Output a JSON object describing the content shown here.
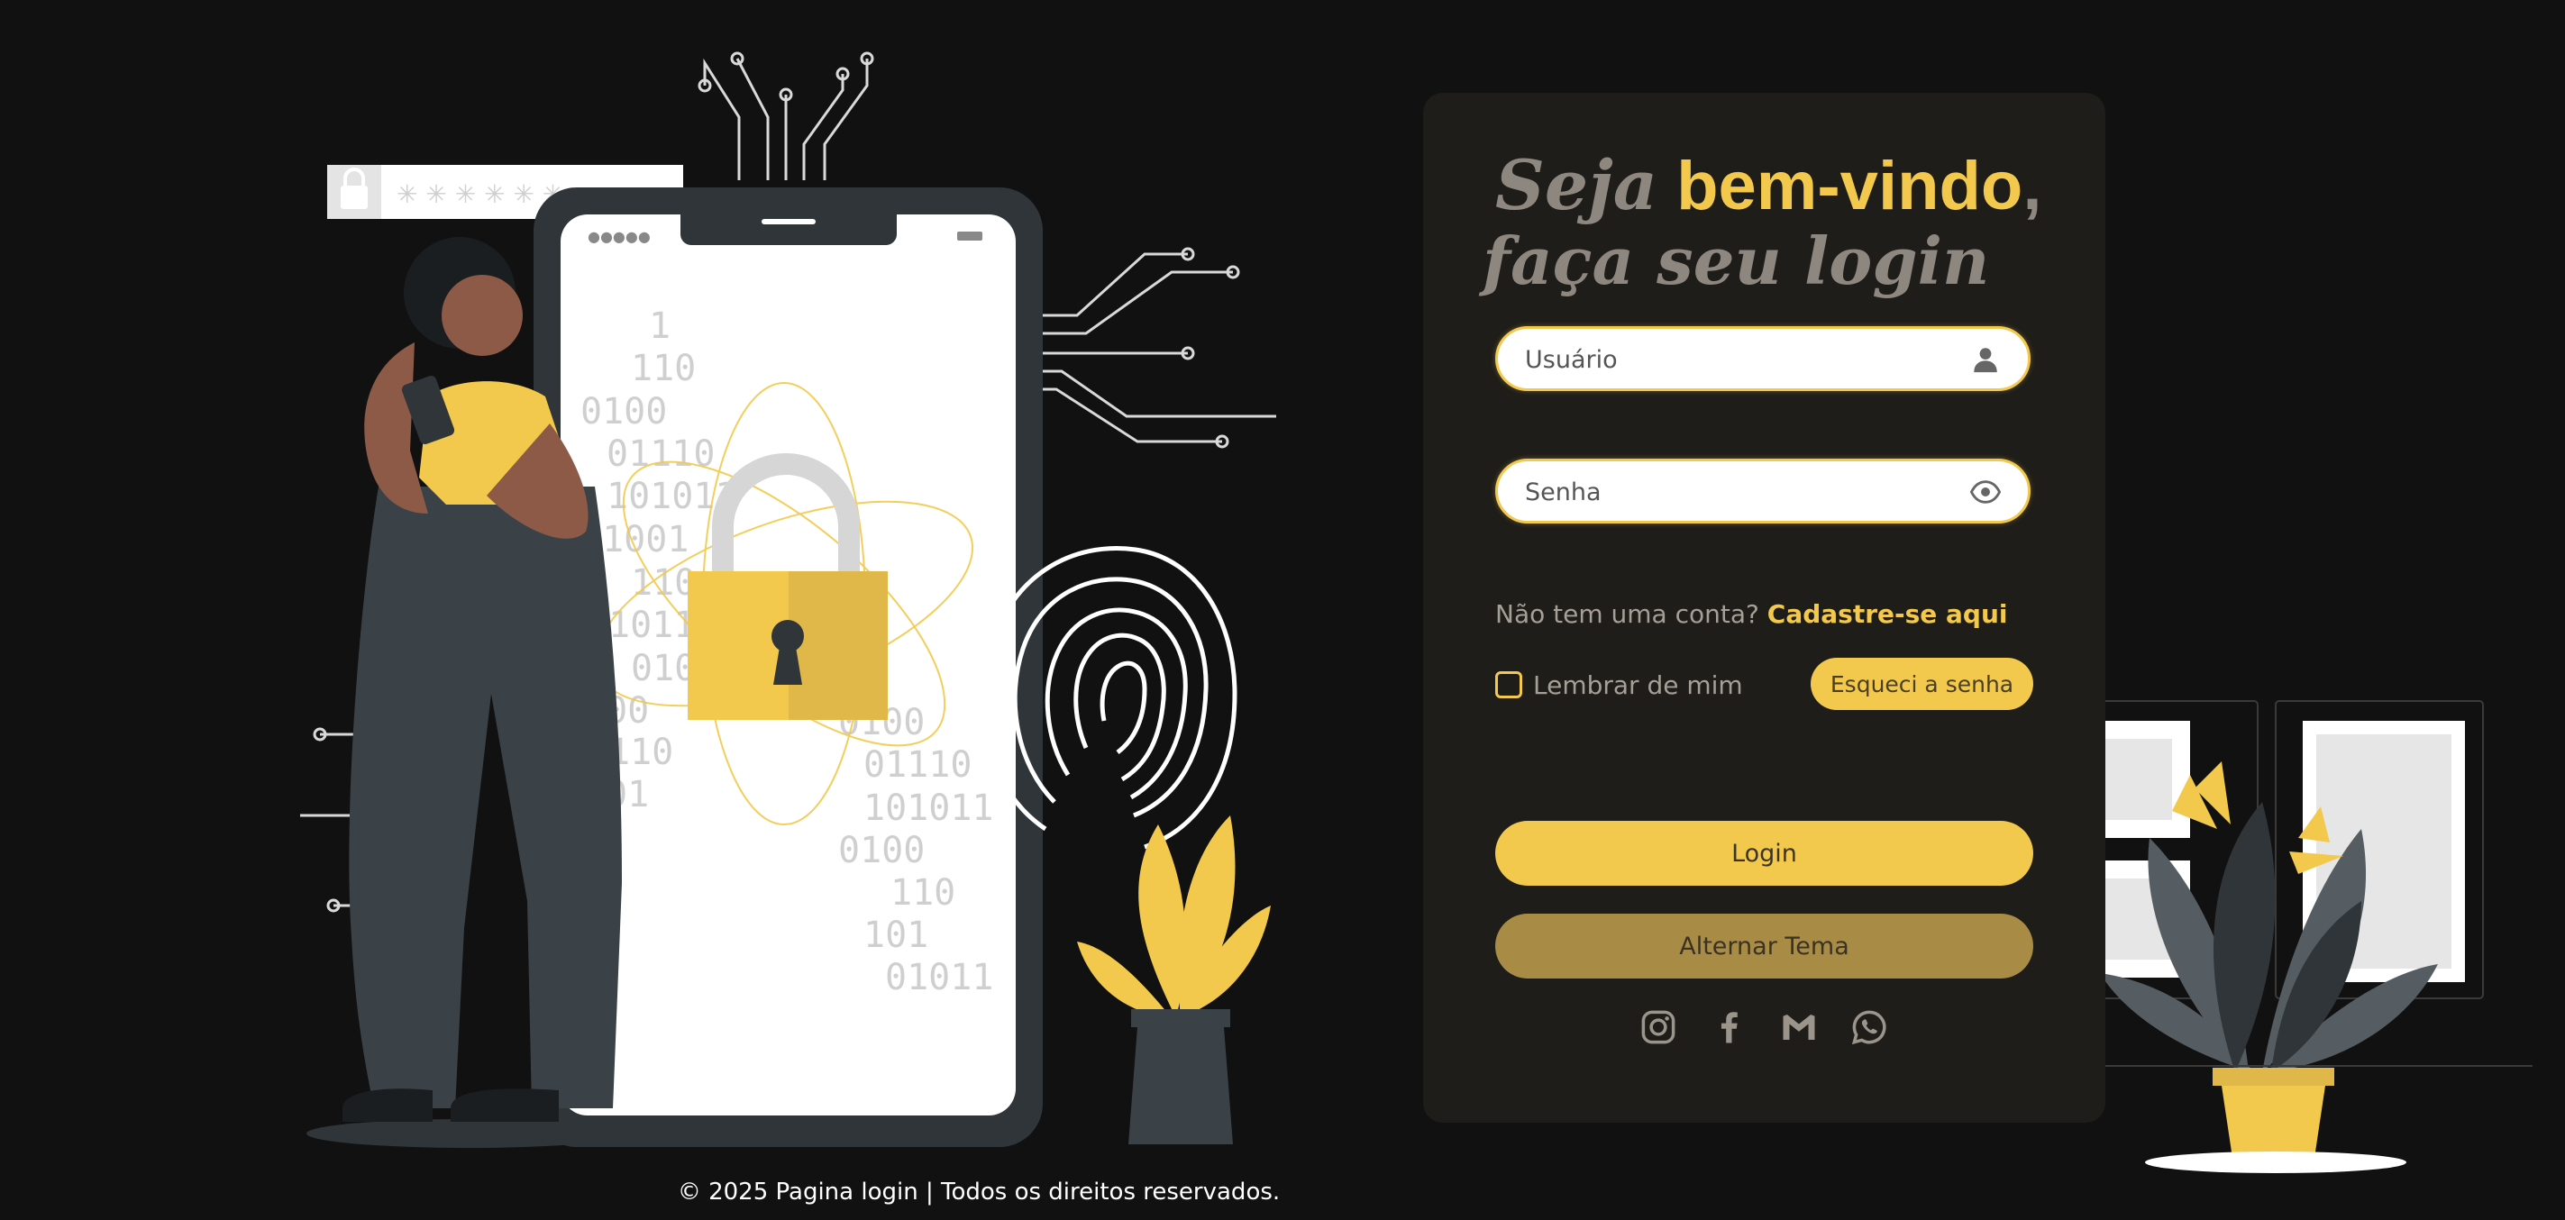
{
  "title": {
    "seja": "Seja",
    "bemvindo": "bem-vindo",
    "comma": ",",
    "line2": "faça seu login"
  },
  "fields": {
    "user_placeholder": "Usuário",
    "pass_placeholder": "Senha"
  },
  "signup": {
    "text": "Não tem uma conta?",
    "link": "Cadastre-se aqui"
  },
  "remember": {
    "label": "Lembrar de mim"
  },
  "forgot_button": "Esqueci a senha",
  "login_button": "Login",
  "theme_button": "Alternar Tema",
  "socials": [
    "instagram-icon",
    "facebook-icon",
    "gmail-icon",
    "whatsapp-icon"
  ],
  "illustration": {
    "binary_lines": [
      "1",
      "110",
      "0100",
      "01110",
      "101011",
      "01001",
      "110",
      "1011",
      "010",
      "100",
      "110",
      "01"
    ],
    "binary_lines_right": [
      "0100",
      "01110",
      "101011",
      "0100",
      "110",
      "101",
      "01011"
    ],
    "password_mask": "✳ ✳ ✳ ✳ ✳ ✳"
  },
  "footer": "© 2025 Pagina login | Todos os direitos reservados.",
  "colors": {
    "background": "#111111",
    "card": "#1f1d19",
    "accent": "#f2c94c",
    "muted": "#a59f96",
    "theme_button": "#a88c45"
  }
}
